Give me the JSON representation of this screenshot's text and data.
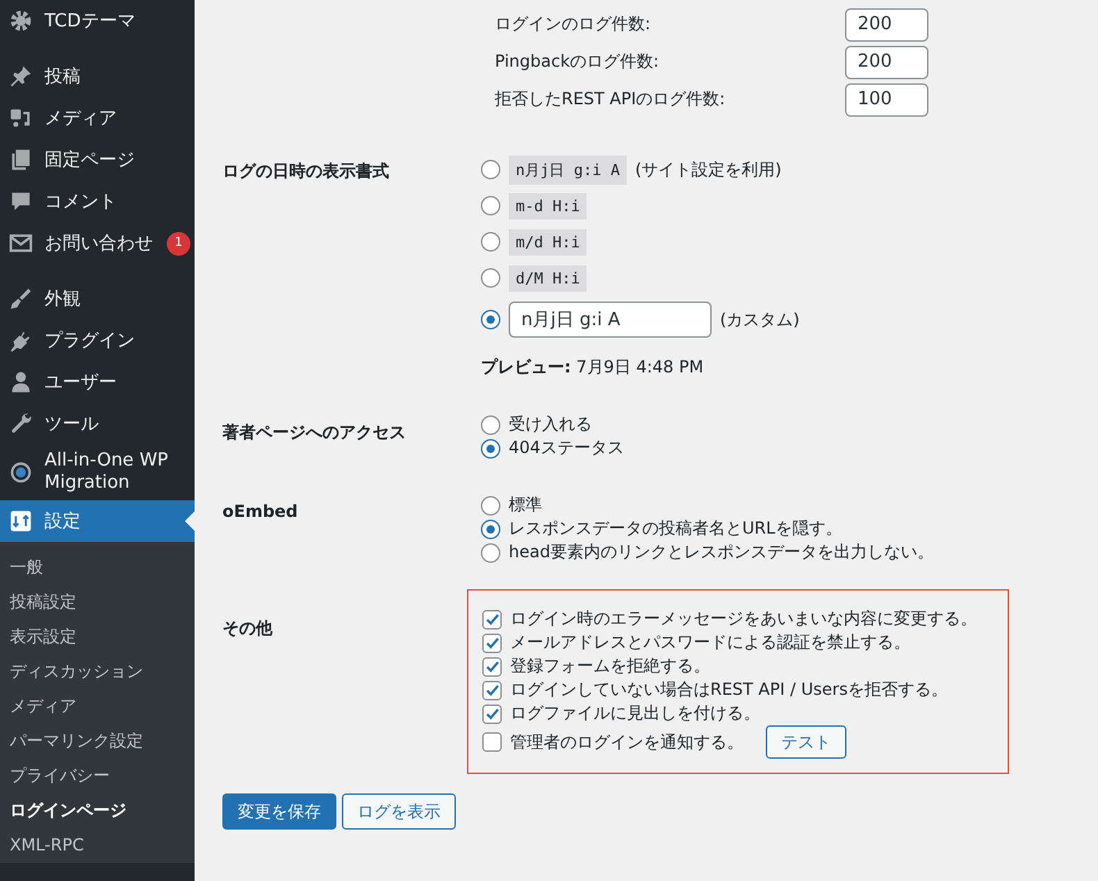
{
  "sidebar": {
    "groups": [
      [
        {
          "label": "TCDテーマ",
          "selected": false
        }
      ],
      [
        {
          "label": "投稿",
          "selected": false
        },
        {
          "label": "メディア",
          "selected": false
        },
        {
          "label": "固定ページ",
          "selected": false
        },
        {
          "label": "コメント",
          "selected": false
        },
        {
          "label": "お問い合わせ",
          "selected": false,
          "badge": "1"
        }
      ],
      [
        {
          "label": "外観",
          "selected": false
        },
        {
          "label": "プラグイン",
          "selected": false
        },
        {
          "label": "ユーザー",
          "selected": false
        },
        {
          "label": "ツール",
          "selected": false
        },
        {
          "label": "All-in-One WP Migration",
          "selected": false
        },
        {
          "label": "設定",
          "selected": true
        }
      ]
    ],
    "submenu": [
      {
        "label": "一般",
        "selected": false
      },
      {
        "label": "投稿設定",
        "selected": false
      },
      {
        "label": "表示設定",
        "selected": false
      },
      {
        "label": "ディスカッション",
        "selected": false
      },
      {
        "label": "メディア",
        "selected": false
      },
      {
        "label": "パーマリンク設定",
        "selected": false
      },
      {
        "label": "プライバシー",
        "selected": false
      },
      {
        "label": "ログインページ",
        "selected": true
      },
      {
        "label": "XML-RPC",
        "selected": false
      }
    ]
  },
  "log_counts": [
    {
      "label": "ログインのログ件数:",
      "value": "200"
    },
    {
      "label": "Pingbackのログ件数:",
      "value": "200"
    },
    {
      "label": "拒否したREST APIのログ件数:",
      "value": "100"
    }
  ],
  "sections": [
    {
      "kind": "radios",
      "label": "ログの日時の表示書式",
      "highlighted": false,
      "options": [
        {
          "kind": "code",
          "code": "n月j日 g:i A",
          "note": "(サイト設定を利用)",
          "selected": false
        },
        {
          "kind": "code",
          "code": "m-d H:i",
          "selected": false
        },
        {
          "kind": "code",
          "code": "m/d H:i",
          "selected": false
        },
        {
          "kind": "code",
          "code": "d/M H:i",
          "selected": false
        },
        {
          "kind": "custom",
          "value": "n月j日 g:i A",
          "note": "(カスタム)",
          "selected": true
        }
      ],
      "preview": "**プレビュー:** 7月9日 4:48 PM"
    },
    {
      "kind": "radios",
      "label": "著者ページへのアクセス",
      "highlighted": false,
      "options": [
        {
          "kind": "text",
          "label": "受け入れる",
          "selected": false
        },
        {
          "kind": "text",
          "label": "404ステータス",
          "selected": true
        }
      ]
    },
    {
      "kind": "radios",
      "label": "oEmbed",
      "highlighted": false,
      "options": [
        {
          "kind": "text",
          "label": "標準",
          "selected": false
        },
        {
          "kind": "text",
          "label": "レスポンスデータの投稿者名とURLを隠す。",
          "selected": true
        },
        {
          "kind": "text",
          "label": "head要素内のリンクとレスポンスデータを出力しない。",
          "selected": false
        }
      ]
    },
    {
      "kind": "checks",
      "label": "その他",
      "highlighted": true,
      "options": [
        {
          "label": "ログイン時のエラーメッセージをあいまいな内容に変更する。",
          "checked": true
        },
        {
          "label": "メールアドレスとパスワードによる認証を禁止する。",
          "checked": true
        },
        {
          "label": "登録フォームを拒絶する。",
          "checked": true
        },
        {
          "label": "ログインしていない場合はREST API / Usersを拒否する。",
          "checked": true
        },
        {
          "label": "ログファイルに見出しを付ける。",
          "checked": true
        },
        {
          "label": "管理者のログインを通知する。",
          "checked": false,
          "button": "テスト"
        }
      ]
    }
  ],
  "buttons": [
    {
      "label": "変更を保存",
      "kind": "primary"
    },
    {
      "label": "ログを表示",
      "kind": "secondary"
    }
  ]
}
